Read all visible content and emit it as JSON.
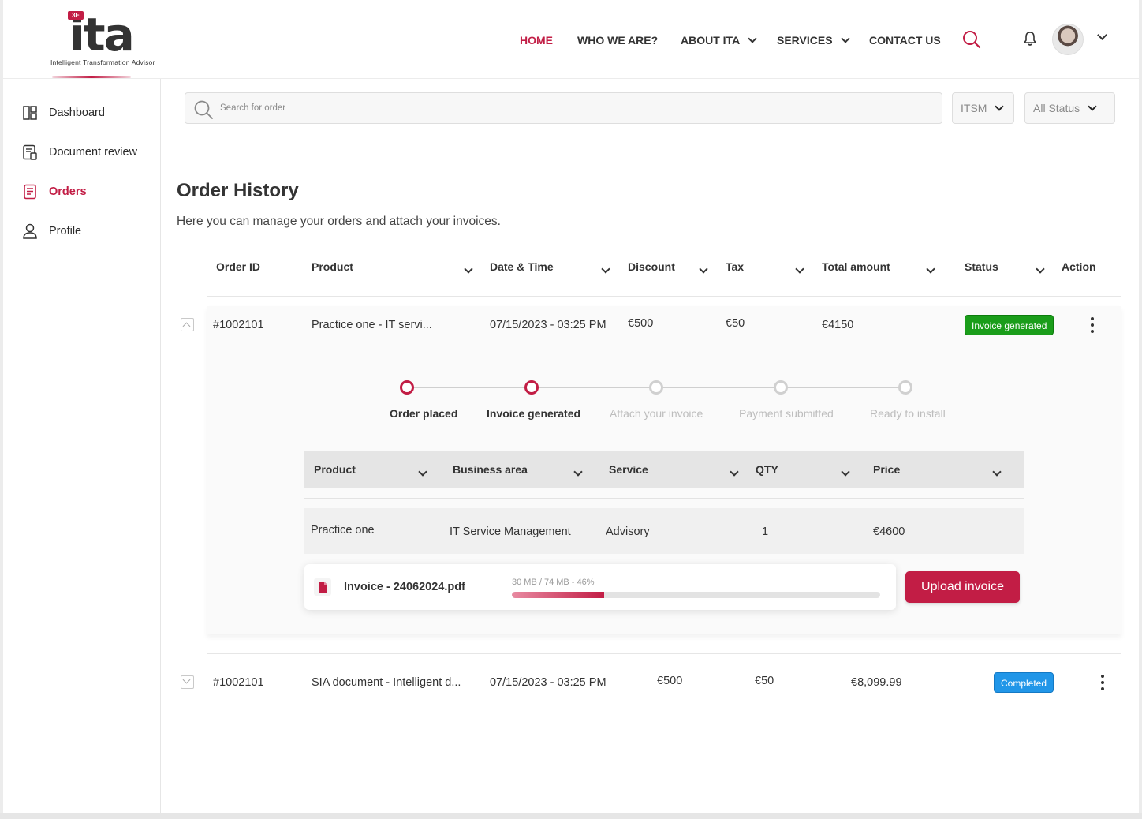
{
  "brand": {
    "logo_text": "ita",
    "logo_badge": "3E",
    "logo_tagline": "Intelligent Transformation Advisor",
    "accent_color": "#c21d45"
  },
  "topnav": {
    "items": [
      {
        "label": "HOME",
        "active": true
      },
      {
        "label": "WHO WE ARE?"
      },
      {
        "label": "ABOUT ITA",
        "has_dropdown": true
      },
      {
        "label": "SERVICES",
        "has_dropdown": true
      },
      {
        "label": "CONTACT US"
      }
    ],
    "icons": [
      "search-icon",
      "bell-icon",
      "avatar",
      "chevron-down-icon"
    ]
  },
  "sidebar": {
    "items": [
      {
        "label": "Dashboard",
        "icon": "dashboard-icon"
      },
      {
        "label": "Document review",
        "icon": "document-review-icon"
      },
      {
        "label": "Orders",
        "icon": "orders-icon",
        "active": true
      },
      {
        "label": "Profile",
        "icon": "profile-icon"
      }
    ]
  },
  "filters": {
    "search_placeholder": "Search for order",
    "category": "ITSM",
    "status": "All Status"
  },
  "page": {
    "title": "Order History",
    "subtitle": "Here you can manage your orders and attach your invoices."
  },
  "table": {
    "columns": [
      "Order ID",
      "Product",
      "Date & Time",
      "Discount",
      "Tax",
      "Total amount",
      "Status",
      "Action"
    ],
    "rows": [
      {
        "order_id": "#1002101",
        "product": "Practice one - IT servi...",
        "datetime": "07/15/2023 - 03:25 PM",
        "discount": "€500",
        "tax": "€50",
        "total": "€4150",
        "status": "Invoice generated",
        "status_color": "#1a9d1a",
        "expanded": true
      },
      {
        "order_id": "#1002101",
        "product": "SIA document - Intelligent d...",
        "datetime": "07/15/2023 - 03:25 PM",
        "discount": "€500",
        "tax": "€50",
        "total": "€8,099.99",
        "status": "Completed",
        "status_color": "#2196e8",
        "expanded": false
      }
    ]
  },
  "stepper": {
    "steps": [
      {
        "label": "Order placed",
        "done": true
      },
      {
        "label": "Invoice generated",
        "done": true
      },
      {
        "label": "Attach your invoice",
        "done": false
      },
      {
        "label": "Payment submitted",
        "done": false
      },
      {
        "label": "Ready to install",
        "done": false
      }
    ]
  },
  "detail": {
    "columns": [
      "Product",
      "Business area",
      "Service",
      "QTY",
      "Price"
    ],
    "row": {
      "product": "Practice one",
      "business_area": "IT Service Management",
      "service": "Advisory",
      "qty": "1",
      "price": "€4600"
    }
  },
  "upload": {
    "file_name": "Invoice - 24062024.pdf",
    "progress_text": "30 MB / 74 MB - 46%",
    "progress_fraction": 0.25,
    "button_label": "Upload invoice"
  }
}
